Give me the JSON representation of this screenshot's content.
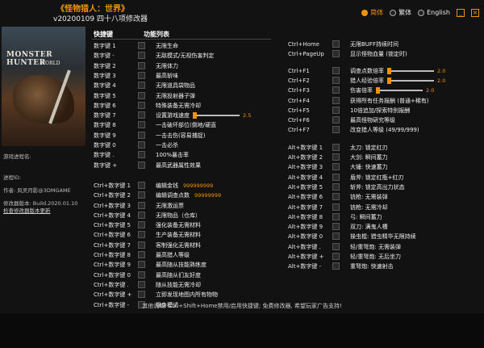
{
  "header": {
    "title": "《怪物猎人：世界》",
    "version": "v20200109 四十八项修改器"
  },
  "language": {
    "options": [
      {
        "label": "简体",
        "selected": true
      },
      {
        "label": "繁体",
        "selected": false
      },
      {
        "label": "English",
        "selected": false
      }
    ],
    "minimize": "_",
    "close": "×"
  },
  "cover": {
    "line1": "MONSTER HUNTER",
    "line2": "WORLD"
  },
  "left_info": {
    "process_label": "游戏进程名:",
    "process_id_label": "进程ID:",
    "author": "作者: 风灵月影@3DMGAME",
    "build": "修改器版本: Build.2020.01.10",
    "check_update": "检查修改器版本更新"
  },
  "columns": {
    "hotkey": "快捷键",
    "functions": "功能列表"
  },
  "left_rows": [
    {
      "key": "数字键 1",
      "label": "无限生命"
    },
    {
      "key": "数字键 -",
      "label": "无敌模式/无视伤害判定"
    },
    {
      "key": "数字键 2",
      "label": "无限体力"
    },
    {
      "key": "数字键 3",
      "label": "最高斩味"
    },
    {
      "key": "数字键 4",
      "label": "无限道具袋物品"
    },
    {
      "key": "数字键 5",
      "label": "无限投射器子弹"
    },
    {
      "key": "数字键 6",
      "label": "特殊装备无需冷却"
    },
    {
      "key": "数字键 7",
      "label": "设置游戏速度",
      "slider": "2.5"
    },
    {
      "key": "数字键 8",
      "label": "一击破坏部位(倒地/硬直"
    },
    {
      "key": "数字键 9",
      "label": "一击击伤(容易捕捉)"
    },
    {
      "key": "数字键 0",
      "label": "一击必杀"
    },
    {
      "key": "数字键 .",
      "label": "100%暴击率"
    },
    {
      "key": "数字键 +",
      "label": "最高武器属性效果"
    },
    {
      "key": "Ctrl+数字键 1",
      "label": "编辑金钱",
      "value": "999999999"
    },
    {
      "key": "Ctrl+数字键 2",
      "label": "编辑调查点数",
      "value": "99999999"
    },
    {
      "key": "Ctrl+数字键 3",
      "label": "无限激运票"
    },
    {
      "key": "Ctrl+数字键 4",
      "label": "无限物品（仓库）"
    },
    {
      "key": "Ctrl+数字键 5",
      "label": "强化装备无需材料"
    },
    {
      "key": "Ctrl+数字键 6",
      "label": "生产装备无需材料"
    },
    {
      "key": "Ctrl+数字键 7",
      "label": "客制强化无需材料"
    },
    {
      "key": "Ctrl+数字键 8",
      "label": "最高猎人等级"
    },
    {
      "key": "Ctrl+数字键 9",
      "label": "最高随从技能熟练度"
    },
    {
      "key": "Ctrl+数字键 0",
      "label": "最高随从们友好度"
    },
    {
      "key": "Ctrl+数字键 .",
      "label": "随从技能无需冷却"
    },
    {
      "key": "Ctrl+数字键 +",
      "label": "立即发现地图内所有物物"
    },
    {
      "key": "Ctrl+数字键 -",
      "label": "隐身模式"
    }
  ],
  "right_rows": [
    {
      "key": "Ctrl+Home",
      "label": "无限BUFF持续时间"
    },
    {
      "key": "Ctrl+PageUp",
      "label": "显示怪物血量 (锁定时)"
    },
    {
      "key": "Ctrl+F1",
      "label": "调查点数倍率",
      "slider": "2.0"
    },
    {
      "key": "Ctrl+F2",
      "label": "猎人经验倍率",
      "slider": "2.0"
    },
    {
      "key": "Ctrl+F3",
      "label": "伤害倍率",
      "slider": "2.0"
    },
    {
      "key": "Ctrl+F4",
      "label": "获得所有任务报酬 (普通+稀有)"
    },
    {
      "key": "Ctrl+F5",
      "label": "10倍追加/探索特别报酬"
    },
    {
      "key": "Ctrl+F6",
      "label": "最高怪物研究等级"
    },
    {
      "key": "Ctrl+F7",
      "label": "改变猎人等级 (49/99/999)"
    },
    {
      "key": "Alt+数字键 1",
      "label": "太刀: 锁定红刃"
    },
    {
      "key": "Alt+数字键 2",
      "label": "大剑: 瞬间蓄力"
    },
    {
      "key": "Alt+数字键 3",
      "label": "大锤: 快速蓄力"
    },
    {
      "key": "Alt+数字键 4",
      "label": "盾斧: 锁定红瓶+红刃"
    },
    {
      "key": "Alt+数字键 5",
      "label": "斩斧: 锁定高出力状态"
    },
    {
      "key": "Alt+数字键 6",
      "label": "铳枪: 无需装弹"
    },
    {
      "key": "Alt+数字键 7",
      "label": "铳枪: 无需冷却"
    },
    {
      "key": "Alt+数字键 8",
      "label": "弓: 瞬间蓄力"
    },
    {
      "key": "Alt+数字键 9",
      "label": "双刀: 满鬼人槽"
    },
    {
      "key": "Alt+数字键 0",
      "label": "操虫棍: 猎虫精华无限持续"
    },
    {
      "key": "Alt+数字键 .",
      "label": "轻/重弩炮: 无需装弹"
    },
    {
      "key": "Alt+数字键 +",
      "label": "轻/重弩炮: 无后坐力"
    },
    {
      "key": "Alt+数字键 -",
      "label": "重弩炮: 快速射击"
    }
  ],
  "footer": "其他说明: Ctrl+Shift+Home禁用/启用快捷键; 免费修改器, 希望玩家广告支持!"
}
